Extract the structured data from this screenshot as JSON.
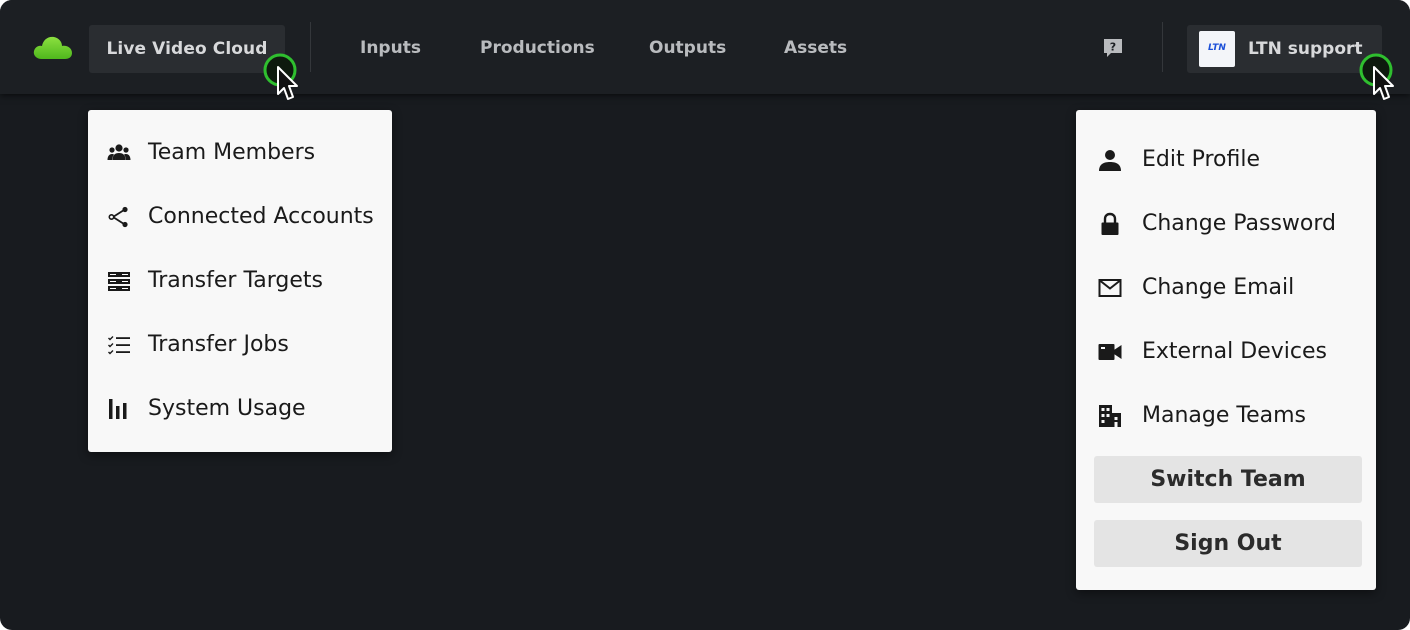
{
  "app": {
    "workspace_label": "Live Video Cloud"
  },
  "nav": {
    "items": [
      {
        "label": "Inputs"
      },
      {
        "label": "Productions"
      },
      {
        "label": "Outputs"
      },
      {
        "label": "Assets"
      }
    ]
  },
  "header": {
    "help_icon": "help-chat-icon",
    "user": {
      "name": "LTN support",
      "avatar_text": "LTN"
    }
  },
  "workspace_menu": {
    "items": [
      {
        "label": "Team Members",
        "icon": "people-icon"
      },
      {
        "label": "Connected Accounts",
        "icon": "share-nodes-icon"
      },
      {
        "label": "Transfer Targets",
        "icon": "server-stack-icon"
      },
      {
        "label": "Transfer Jobs",
        "icon": "checklist-icon"
      },
      {
        "label": "System Usage",
        "icon": "bar-chart-icon"
      }
    ]
  },
  "user_menu": {
    "items": [
      {
        "label": "Edit Profile",
        "icon": "person-icon"
      },
      {
        "label": "Change Password",
        "icon": "lock-icon"
      },
      {
        "label": "Change Email",
        "icon": "envelope-icon"
      },
      {
        "label": "External Devices",
        "icon": "video-camera-icon"
      },
      {
        "label": "Manage Teams",
        "icon": "building-icon"
      }
    ],
    "switch_team_label": "Switch Team",
    "sign_out_label": "Sign Out"
  },
  "colors": {
    "brand_green": "#6fd12b",
    "cursor_ring": "#2fbf2f",
    "background": "#181b1f",
    "menu_bg": "#f8f8f8"
  }
}
